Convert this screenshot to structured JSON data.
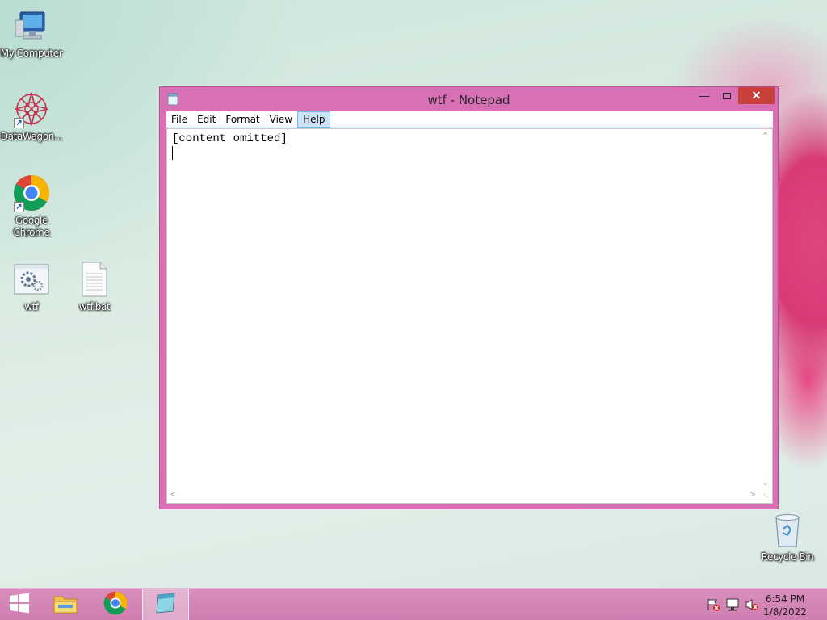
{
  "desktop": {
    "icons": [
      {
        "label": "My Computer",
        "icon": "computer-icon"
      },
      {
        "label": "DataWagon...",
        "icon": "datawagon-icon"
      },
      {
        "label": "Google Chrome",
        "icon": "chrome-icon"
      },
      {
        "label": "wtf",
        "icon": "settings-file-icon"
      },
      {
        "label": "wtf.bat",
        "icon": "text-file-icon"
      },
      {
        "label": "Recycle Bin",
        "icon": "recycle-bin-icon"
      }
    ]
  },
  "notepad": {
    "title": "wtf - Notepad",
    "menu": [
      "File",
      "Edit",
      "Format",
      "View",
      "Help"
    ],
    "active_menu": "Help",
    "content": "[content omitted]"
  },
  "taskbar": {
    "items": [
      "start-button",
      "file-explorer",
      "google-chrome",
      "notepad"
    ],
    "time": "6:54 PM",
    "date": "1/8/2022"
  },
  "colors": {
    "window_frame": "#d970b6",
    "taskbar": "#d488b8",
    "close_button": "#c7403a"
  }
}
